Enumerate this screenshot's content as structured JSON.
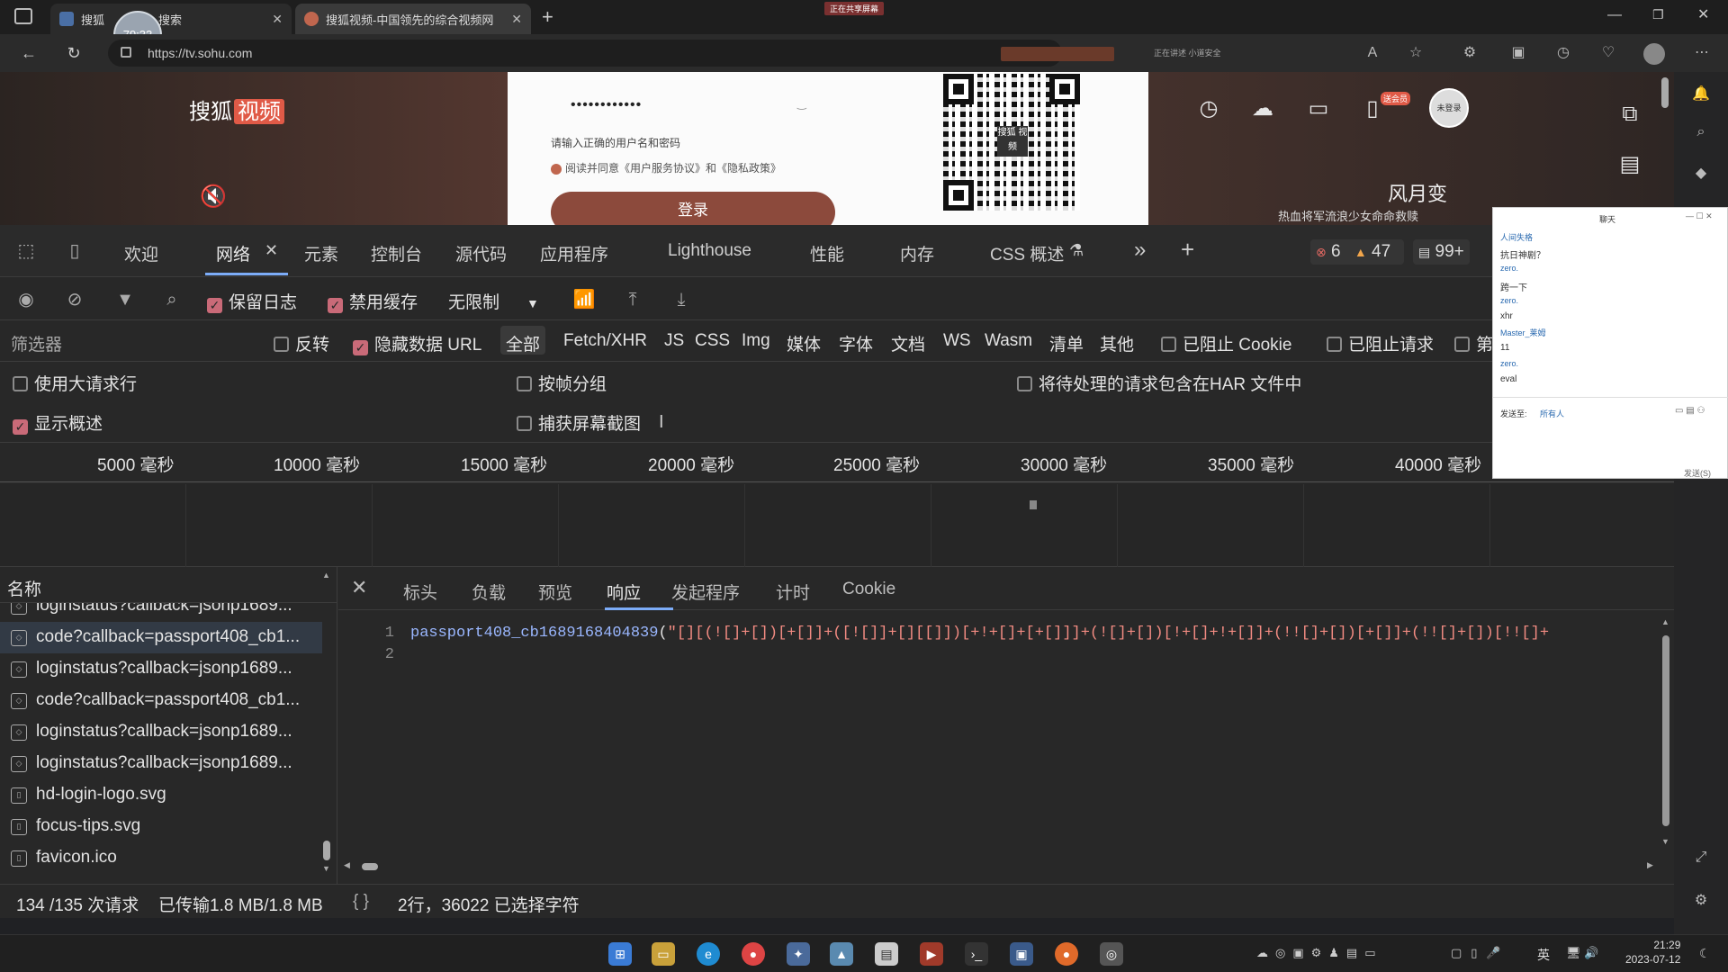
{
  "browser": {
    "tabs": [
      {
        "title": "搜狐",
        "title_suffix": "搜索",
        "active": false
      },
      {
        "title": "搜狐视频-中国领先的综合视频网",
        "active": true
      }
    ],
    "new_tab": "+",
    "url": "https://tv.sohu.com",
    "recording_badge": "正在共享屏幕",
    "toolbar_hint": "正在讲述 小道安全"
  },
  "timer_overlay": "79:33",
  "page": {
    "logo_text": "搜狐",
    "logo_highlight": "视频",
    "password_mask": "••••••••••••",
    "error_text": "请输入正确的用户名和密码",
    "agree_text": "阅读并同意《用户服务协议》和《隐私政策》",
    "login_button": "登录",
    "qr_label": "搜狐 视频",
    "vip_tag": "送会员",
    "avatar_text": "未登录",
    "promo_title": "风月变",
    "promo_sub": "热血将军流浪少女命命救赎"
  },
  "devtools": {
    "tabs": [
      "欢迎",
      "网络",
      "元素",
      "控制台",
      "源代码",
      "应用程序",
      "Lighthouse",
      "性能",
      "内存",
      "CSS 概述"
    ],
    "active_tab": "网络",
    "errors": "6",
    "warnings": "47",
    "messages": "99+",
    "toolbar": {
      "preserve_log": "保留日志",
      "disable_cache": "禁用缓存",
      "throttle": "无限制"
    },
    "filter": {
      "placeholder": "筛选器",
      "invert": "反转",
      "hide_data_url": "隐藏数据 URL",
      "types": [
        "全部",
        "Fetch/XHR",
        "JS",
        "CSS",
        "Img",
        "媒体",
        "字体",
        "文档",
        "WS",
        "Wasm",
        "清单",
        "其他"
      ],
      "blocked_cookie": "已阻止 Cookie",
      "blocked_requests": "已阻止请求",
      "third_party": "第"
    },
    "options": {
      "large_rows": "使用大请求行",
      "group_by_frame": "按帧分组",
      "har": "将待处理的请求包含在HAR 文件中",
      "show_overview": "显示概述",
      "screenshots": "捕获屏幕截图"
    },
    "timeline_ticks": [
      "5000 毫秒",
      "10000 毫秒",
      "15000 毫秒",
      "20000 毫秒",
      "25000 毫秒",
      "30000 毫秒",
      "35000 毫秒",
      "40000 毫秒"
    ],
    "name_header": "名称",
    "requests": [
      {
        "name": "loginstatus?callback=jsonp1689...",
        "icon": "xhr"
      },
      {
        "name": "code?callback=passport408_cb1...",
        "icon": "xhr",
        "selected": true
      },
      {
        "name": "loginstatus?callback=jsonp1689...",
        "icon": "xhr"
      },
      {
        "name": "code?callback=passport408_cb1...",
        "icon": "xhr"
      },
      {
        "name": "loginstatus?callback=jsonp1689...",
        "icon": "xhr"
      },
      {
        "name": "loginstatus?callback=jsonp1689...",
        "icon": "xhr"
      },
      {
        "name": "hd-login-logo.svg",
        "icon": "file"
      },
      {
        "name": "focus-tips.svg",
        "icon": "file"
      },
      {
        "name": "favicon.ico",
        "icon": "file"
      }
    ],
    "detail_tabs": [
      "标头",
      "负载",
      "预览",
      "响应",
      "发起程序",
      "计时",
      "Cookie"
    ],
    "active_detail_tab": "响应",
    "response": {
      "line_numbers": [
        "1",
        "2"
      ],
      "fn": "passport408_cb1689168404839",
      "paren": "(",
      "str": "\"[][(![]+[])[+[]]+([![]]+[][[]])[+!+[]+[+[]]]+(![]+[])[!+[]+!+[]]+(!![]+[])[+[]]+(!![]+[])[!![]+"
    },
    "status": {
      "requests": "134 /135 次请求",
      "transferred": "已传输1.8 MB/1.8 MB",
      "braces": "{ }",
      "selection": "2行，36022 已选择字符"
    }
  },
  "chat": {
    "title": "聊天",
    "lines": [
      "人间失格",
      "抗日神剧？",
      "zero.",
      "跨一下",
      "zero.",
      "xhr",
      "Master_莱姆",
      "11",
      "zero.",
      "eval"
    ],
    "send_to_label": "发送至:",
    "send_to_value": "所有人",
    "send_button": "发送(S)"
  },
  "taskbar": {
    "time": "21:29",
    "date": "2023-07-12",
    "ime": "英"
  }
}
